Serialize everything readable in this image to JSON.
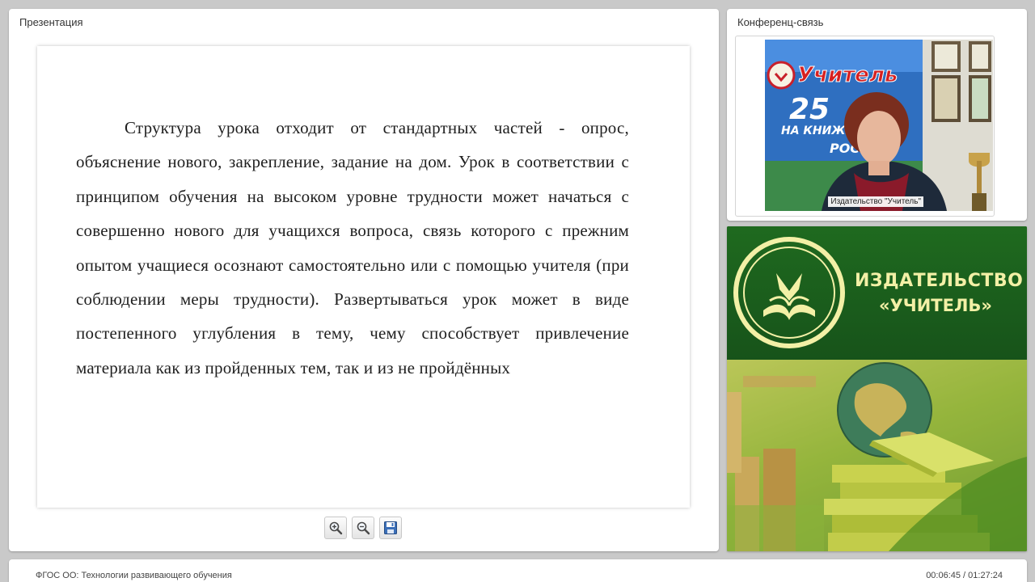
{
  "presentation": {
    "title": "Презентация",
    "slide_text": "Структура урока отходит от стандартных частей - опрос, объяснение нового, закрепление, задание на дом. Урок в соответствии с принципом обучения на высоком уровне трудности может начаться с совершенно нового для учащихся вопроса, связь которого с прежним опытом учащиеся осознают самостоятельно или с помощью учителя (при соблюдении меры трудности). Развертываться урок может в виде постепенного углубления в тему, чему способствует привлечение материала как из пройденных тем, так и из не пройдённых",
    "toolbar": [
      {
        "name": "zoom-in-icon"
      },
      {
        "name": "zoom-out-icon"
      },
      {
        "name": "save-icon"
      }
    ]
  },
  "conference": {
    "title": "Конференц-связь",
    "participant_label": "Издательство \"Учитель\"",
    "banner_text": [
      "Учитель",
      "25",
      "НА КНИЖНОМ",
      "РОССИ"
    ]
  },
  "brand": {
    "line1": "ИЗДАТЕЛЬСТВО",
    "line2": "«УЧИТЕЛЬ»"
  },
  "footer": {
    "course_title": "ФГОС ОО: Технологии развивающего обучения",
    "timecode": "00:06:45 / 01:27:24"
  },
  "colors": {
    "brand_green": "#1b5a1b",
    "brand_text": "#f3f0a6"
  }
}
